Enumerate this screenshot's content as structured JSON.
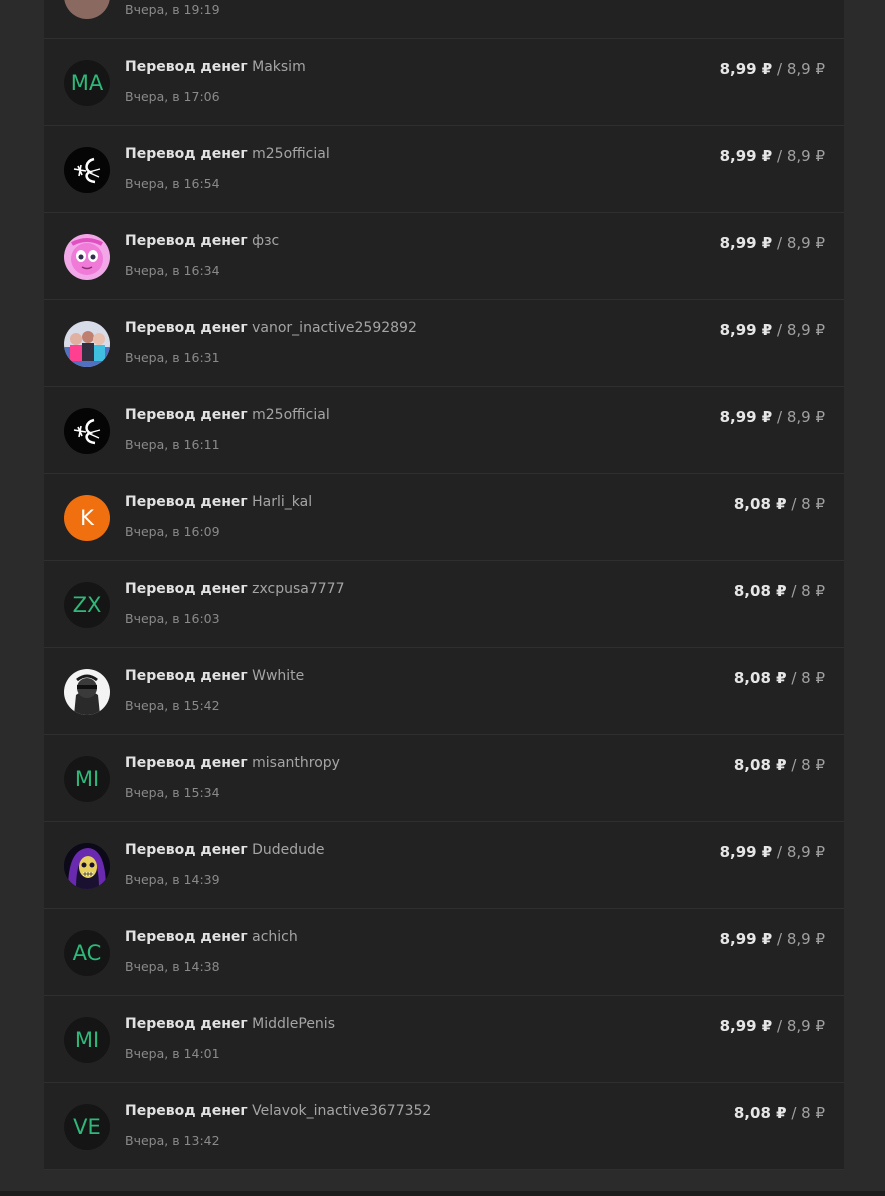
{
  "transactions": [
    {
      "kind": "",
      "user": "",
      "time": "Вчера, в 19:19",
      "amount": "",
      "sep": "",
      "net": "",
      "avatar": {
        "type": "color",
        "initials": "",
        "style": "brown"
      }
    },
    {
      "kind": "Перевод денег",
      "user": "Maksim",
      "time": "Вчера, в 17:06",
      "amount": "8,99 ₽",
      "sep": " / ",
      "net": "8,9 ₽",
      "avatar": {
        "type": "initials",
        "initials": "MA"
      }
    },
    {
      "kind": "Перевод денег",
      "user": "m25official",
      "time": "Вчера, в 16:54",
      "amount": "8,99 ₽",
      "sep": " / ",
      "net": "8,9 ₽",
      "avatar": {
        "type": "image",
        "icon": "white-glyph-on-black-icon"
      }
    },
    {
      "kind": "Перевод денег",
      "user": "фзс",
      "time": "Вчера, в 16:34",
      "amount": "8,99 ₽",
      "sep": " / ",
      "net": "8,9 ₽",
      "avatar": {
        "type": "image",
        "icon": "pink-cartoon-face-icon"
      }
    },
    {
      "kind": "Перевод денег",
      "user": "vanor_inactive2592892",
      "time": "Вчера, в 16:31",
      "amount": "8,99 ₽",
      "sep": " / ",
      "net": "8,9 ₽",
      "avatar": {
        "type": "image",
        "icon": "group-photo-icon"
      }
    },
    {
      "kind": "Перевод денег",
      "user": "m25official",
      "time": "Вчера, в 16:11",
      "amount": "8,99 ₽",
      "sep": " / ",
      "net": "8,9 ₽",
      "avatar": {
        "type": "image",
        "icon": "white-glyph-on-black-icon"
      }
    },
    {
      "kind": "Перевод денег",
      "user": "Harli_kal",
      "time": "Вчера, в 16:09",
      "amount": "8,08 ₽",
      "sep": " / ",
      "net": "8 ₽",
      "avatar": {
        "type": "initials",
        "initials": "K",
        "style": "orange"
      }
    },
    {
      "kind": "Перевод денег",
      "user": "zxcpusa7777",
      "time": "Вчера, в 16:03",
      "amount": "8,08 ₽",
      "sep": " / ",
      "net": "8 ₽",
      "avatar": {
        "type": "initials",
        "initials": "ZX"
      }
    },
    {
      "kind": "Перевод денег",
      "user": "Wwhite",
      "time": "Вчера, в 15:42",
      "amount": "8,08 ₽",
      "sep": " / ",
      "net": "8 ₽",
      "avatar": {
        "type": "image",
        "icon": "masked-figure-icon"
      }
    },
    {
      "kind": "Перевод денег",
      "user": "misanthropy",
      "time": "Вчера, в 15:34",
      "amount": "8,08 ₽",
      "sep": " / ",
      "net": "8 ₽",
      "avatar": {
        "type": "initials",
        "initials": "MI"
      }
    },
    {
      "kind": "Перевод денег",
      "user": "Dudedude",
      "time": "Вчера, в 14:39",
      "amount": "8,99 ₽",
      "sep": " / ",
      "net": "8,9 ₽",
      "avatar": {
        "type": "image",
        "icon": "skeleton-hood-icon"
      }
    },
    {
      "kind": "Перевод денег",
      "user": "achich",
      "time": "Вчера, в 14:38",
      "amount": "8,99 ₽",
      "sep": " / ",
      "net": "8,9 ₽",
      "avatar": {
        "type": "initials",
        "initials": "AC"
      }
    },
    {
      "kind": "Перевод денег",
      "user": "MiddlePenis",
      "time": "Вчера, в 14:01",
      "amount": "8,99 ₽",
      "sep": " / ",
      "net": "8,9 ₽",
      "avatar": {
        "type": "initials",
        "initials": "MI"
      }
    },
    {
      "kind": "Перевод денег",
      "user": "Velavok_inactive3677352",
      "time": "Вчера, в 13:42",
      "amount": "8,08 ₽",
      "sep": " / ",
      "net": "8 ₽",
      "avatar": {
        "type": "initials",
        "initials": "VE"
      }
    }
  ]
}
